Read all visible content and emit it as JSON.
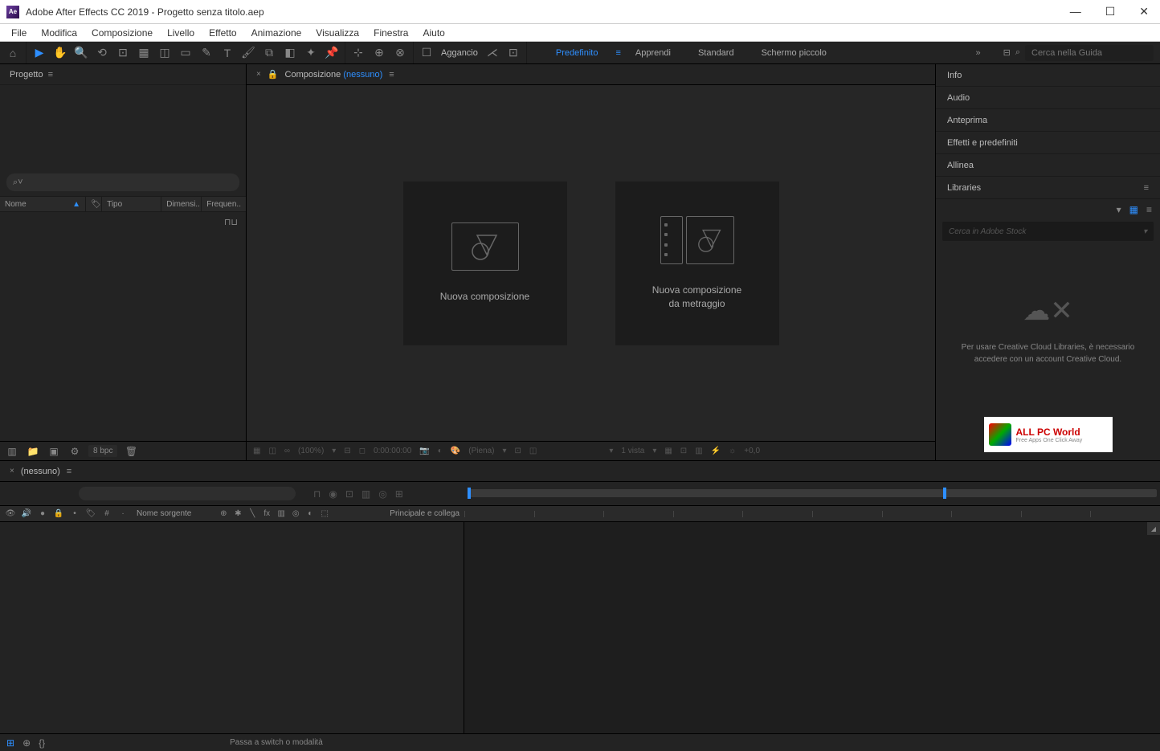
{
  "titlebar": {
    "title": "Adobe After Effects CC 2019 - Progetto senza titolo.aep"
  },
  "menubar": [
    "File",
    "Modifica",
    "Composizione",
    "Livello",
    "Effetto",
    "Animazione",
    "Visualizza",
    "Finestra",
    "Aiuto"
  ],
  "toolbar": {
    "snap_label": "Aggancio",
    "workspaces": [
      {
        "label": "Predefinito",
        "active": true
      },
      {
        "label": "Apprendi",
        "active": false
      },
      {
        "label": "Standard",
        "active": false
      },
      {
        "label": "Schermo piccolo",
        "active": false
      }
    ],
    "search_placeholder": "Cerca nella Guida"
  },
  "project": {
    "tab": "Progetto",
    "columns": [
      "Nome",
      "Tipo",
      "Dimensi..",
      "Frequen.."
    ],
    "bpc": "8 bpc"
  },
  "composition": {
    "tab_prefix": "Composizione",
    "tab_sub": "(nessuno)",
    "card1": "Nuova composizione",
    "card2_line1": "Nuova composizione",
    "card2_line2": "da metraggio",
    "view_zoom": "(100%)",
    "view_time": "0:00:00:00",
    "view_res": "(Piena)",
    "view_count": "1 vista",
    "view_exp": "+0,0"
  },
  "right_panels": [
    "Info",
    "Audio",
    "Anteprima",
    "Effetti e predefiniti",
    "Allinea"
  ],
  "libraries": {
    "title": "Libraries",
    "search_placeholder": "Cerca in Adobe Stock",
    "message": "Per usare Creative Cloud Libraries, è necessario accedere con un account Creative Cloud.",
    "watermark_title": "ALL PC World",
    "watermark_sub": "Free Apps One Click Away"
  },
  "timeline": {
    "tab": "(nessuno)",
    "search_placeholder": "",
    "source_name": "Nome sorgente",
    "parent_label": "Principale e collega"
  },
  "statusbar": {
    "mode_switch": "Passa a switch o modalità"
  }
}
